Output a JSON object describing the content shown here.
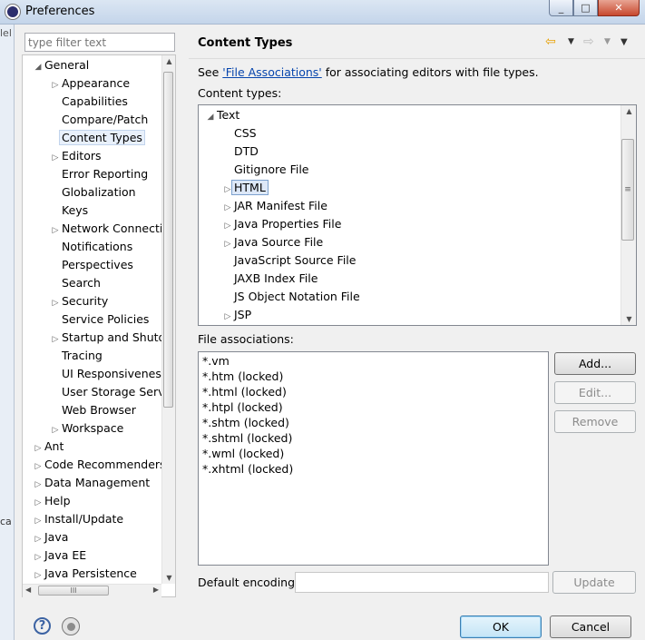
{
  "window": {
    "title": "Preferences",
    "min": "_",
    "max": "□",
    "close": "✕"
  },
  "side_strip": {
    "text1": "lel",
    "text2": "ca"
  },
  "filter": {
    "placeholder": "type filter text"
  },
  "tree": [
    {
      "label": "General",
      "level": 0,
      "arrow": "expanded"
    },
    {
      "label": "Appearance",
      "level": 1,
      "arrow": "collapsed"
    },
    {
      "label": "Capabilities",
      "level": 1,
      "arrow": "none"
    },
    {
      "label": "Compare/Patch",
      "level": 1,
      "arrow": "none"
    },
    {
      "label": "Content Types",
      "level": 1,
      "arrow": "none",
      "selected": true
    },
    {
      "label": "Editors",
      "level": 1,
      "arrow": "collapsed"
    },
    {
      "label": "Error Reporting",
      "level": 1,
      "arrow": "none"
    },
    {
      "label": "Globalization",
      "level": 1,
      "arrow": "none"
    },
    {
      "label": "Keys",
      "level": 1,
      "arrow": "none"
    },
    {
      "label": "Network Connectio",
      "level": 1,
      "arrow": "collapsed"
    },
    {
      "label": "Notifications",
      "level": 1,
      "arrow": "none"
    },
    {
      "label": "Perspectives",
      "level": 1,
      "arrow": "none"
    },
    {
      "label": "Search",
      "level": 1,
      "arrow": "none"
    },
    {
      "label": "Security",
      "level": 1,
      "arrow": "collapsed"
    },
    {
      "label": "Service Policies",
      "level": 1,
      "arrow": "none"
    },
    {
      "label": "Startup and Shutd",
      "level": 1,
      "arrow": "collapsed"
    },
    {
      "label": "Tracing",
      "level": 1,
      "arrow": "none"
    },
    {
      "label": "UI Responsiveness",
      "level": 1,
      "arrow": "none"
    },
    {
      "label": "User Storage Serv",
      "level": 1,
      "arrow": "none"
    },
    {
      "label": "Web Browser",
      "level": 1,
      "arrow": "none"
    },
    {
      "label": "Workspace",
      "level": 1,
      "arrow": "collapsed"
    },
    {
      "label": "Ant",
      "level": 0,
      "arrow": "collapsed"
    },
    {
      "label": "Code Recommenders",
      "level": 0,
      "arrow": "collapsed"
    },
    {
      "label": "Data Management",
      "level": 0,
      "arrow": "collapsed"
    },
    {
      "label": "Help",
      "level": 0,
      "arrow": "collapsed"
    },
    {
      "label": "Install/Update",
      "level": 0,
      "arrow": "collapsed"
    },
    {
      "label": "Java",
      "level": 0,
      "arrow": "collapsed"
    },
    {
      "label": "Java EE",
      "level": 0,
      "arrow": "collapsed"
    },
    {
      "label": "Java Persistence",
      "level": 0,
      "arrow": "collapsed"
    }
  ],
  "page": {
    "title": "Content Types",
    "desc_prefix": "See ",
    "desc_link": "'File Associations'",
    "desc_suffix": " for associating editors with file types.",
    "content_types_label": "Content types:",
    "file_assoc_label": "File associations:",
    "default_encoding_label": "Default encoding:",
    "default_encoding_value": ""
  },
  "content_types": [
    {
      "label": "Text",
      "level": 0,
      "arrow": "expanded"
    },
    {
      "label": "CSS",
      "level": 1,
      "arrow": "none"
    },
    {
      "label": "DTD",
      "level": 1,
      "arrow": "none"
    },
    {
      "label": "Gitignore File",
      "level": 1,
      "arrow": "none"
    },
    {
      "label": "HTML",
      "level": 1,
      "arrow": "collapsed",
      "selected": true
    },
    {
      "label": "JAR Manifest File",
      "level": 1,
      "arrow": "collapsed"
    },
    {
      "label": "Java Properties File",
      "level": 1,
      "arrow": "collapsed"
    },
    {
      "label": "Java Source File",
      "level": 1,
      "arrow": "collapsed"
    },
    {
      "label": "JavaScript Source File",
      "level": 1,
      "arrow": "none"
    },
    {
      "label": "JAXB Index File",
      "level": 1,
      "arrow": "none"
    },
    {
      "label": "JS Object Notation File",
      "level": 1,
      "arrow": "none"
    },
    {
      "label": "JSP",
      "level": 1,
      "arrow": "collapsed"
    }
  ],
  "file_associations": [
    "*.vm",
    "*.htm (locked)",
    "*.html (locked)",
    "*.htpl (locked)",
    "*.shtm (locked)",
    "*.shtml (locked)",
    "*.wml (locked)",
    "*.xhtml (locked)"
  ],
  "buttons": {
    "add": "Add...",
    "edit": "Edit...",
    "remove": "Remove",
    "update": "Update",
    "ok": "OK",
    "cancel": "Cancel"
  },
  "icons": {
    "help": "?",
    "back": "⇦",
    "forward": "⇨",
    "menu": "▼",
    "view_menu": "▼",
    "grip": "≡",
    "hgrip": "III"
  }
}
